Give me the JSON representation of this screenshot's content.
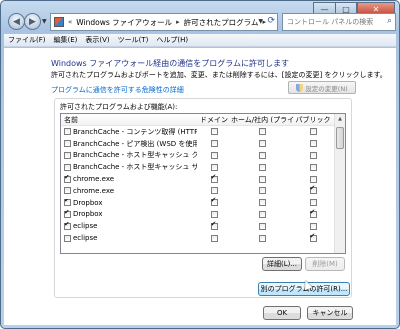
{
  "titlebar": {
    "min_glyph": "—",
    "max_glyph": "□",
    "close_glyph": "✕"
  },
  "address": {
    "back_glyph": "◀",
    "forward_glyph": "▶",
    "dropdown_glyph": "▼",
    "prefix": "«",
    "crumbs": [
      "Windows ファイアウォール",
      "許可されたプログラム"
    ],
    "separator": "▸",
    "refresh_glyph": "⟳",
    "search_placeholder": "コントロール パネルの検索",
    "search_glyph": "⌕"
  },
  "menu": [
    "ファイル(F)",
    "編集(E)",
    "表示(V)",
    "ツール(T)",
    "ヘルプ(H)"
  ],
  "main": {
    "heading": "Windows ファイアウォール経由の通信をプログラムに許可します",
    "description": "許可されたプログラムおよびポートを追加、変更、または削除するには、[設定の変更] をクリックします。",
    "risk_link": "プログラムに通信を許可する危険性の詳細",
    "change_settings_label": "設定の変更(N)",
    "group_label": "許可されたプログラムおよび機能(A):",
    "columns": {
      "name": "名前",
      "domain": "ドメイン",
      "home": "ホーム/社内 (プライ...",
      "public": "パブリック"
    },
    "rows": [
      {
        "name": "BranchCache - コンテンツ取得 (HTTP ...",
        "enabled": false,
        "domain": false,
        "home": false,
        "public": false
      },
      {
        "name": "BranchCache - ピア検出 (WSD を使用)",
        "enabled": false,
        "domain": false,
        "home": false,
        "public": false
      },
      {
        "name": "BranchCache - ホスト型キャッシュ ク...",
        "enabled": false,
        "domain": false,
        "home": false,
        "public": false
      },
      {
        "name": "BranchCache - ホスト型キャッシュ サ...",
        "enabled": false,
        "domain": false,
        "home": false,
        "public": false
      },
      {
        "name": "chrome.exe",
        "enabled": true,
        "domain": true,
        "home": false,
        "public": false
      },
      {
        "name": "chrome.exe",
        "enabled": false,
        "domain": false,
        "home": false,
        "public": true
      },
      {
        "name": "Dropbox",
        "enabled": true,
        "domain": true,
        "home": false,
        "public": false
      },
      {
        "name": "Dropbox",
        "enabled": true,
        "domain": false,
        "home": false,
        "public": true
      },
      {
        "name": "eclipse",
        "enabled": true,
        "domain": true,
        "home": false,
        "public": false
      },
      {
        "name": "eclipse",
        "enabled": false,
        "domain": false,
        "home": false,
        "public": true
      }
    ],
    "scroll_up_glyph": "▲",
    "details_label": "詳細(L)...",
    "delete_label": "削除(M)",
    "allow_other_label": "別のプログラムの許可(R)..."
  },
  "footer": {
    "ok_label": "OK",
    "cancel_label": "キャンセル"
  }
}
